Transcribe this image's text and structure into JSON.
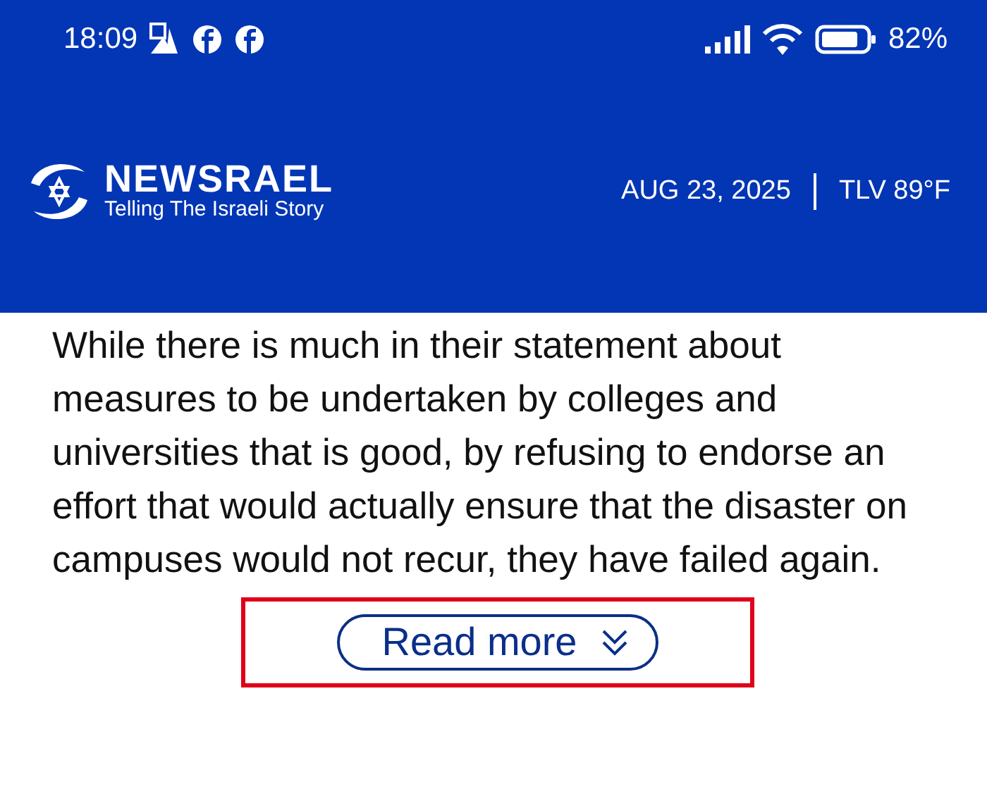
{
  "status_bar": {
    "time": "18:09",
    "battery": "82%"
  },
  "header": {
    "logo_title": "NEWSRAEL",
    "logo_tagline": "Telling The Israeli Story",
    "date": "AUG 23, 2025",
    "weather": "TLV 89°F"
  },
  "article": {
    "paragraph": "While there is much in their statement about measures to be undertaken by colleges and universities that is good, by refusing to endorse an effort that would actually ensure that the disaster on campuses would not recur, they have failed again."
  },
  "read_more": {
    "label": "Read more",
    "highlighted": true
  }
}
